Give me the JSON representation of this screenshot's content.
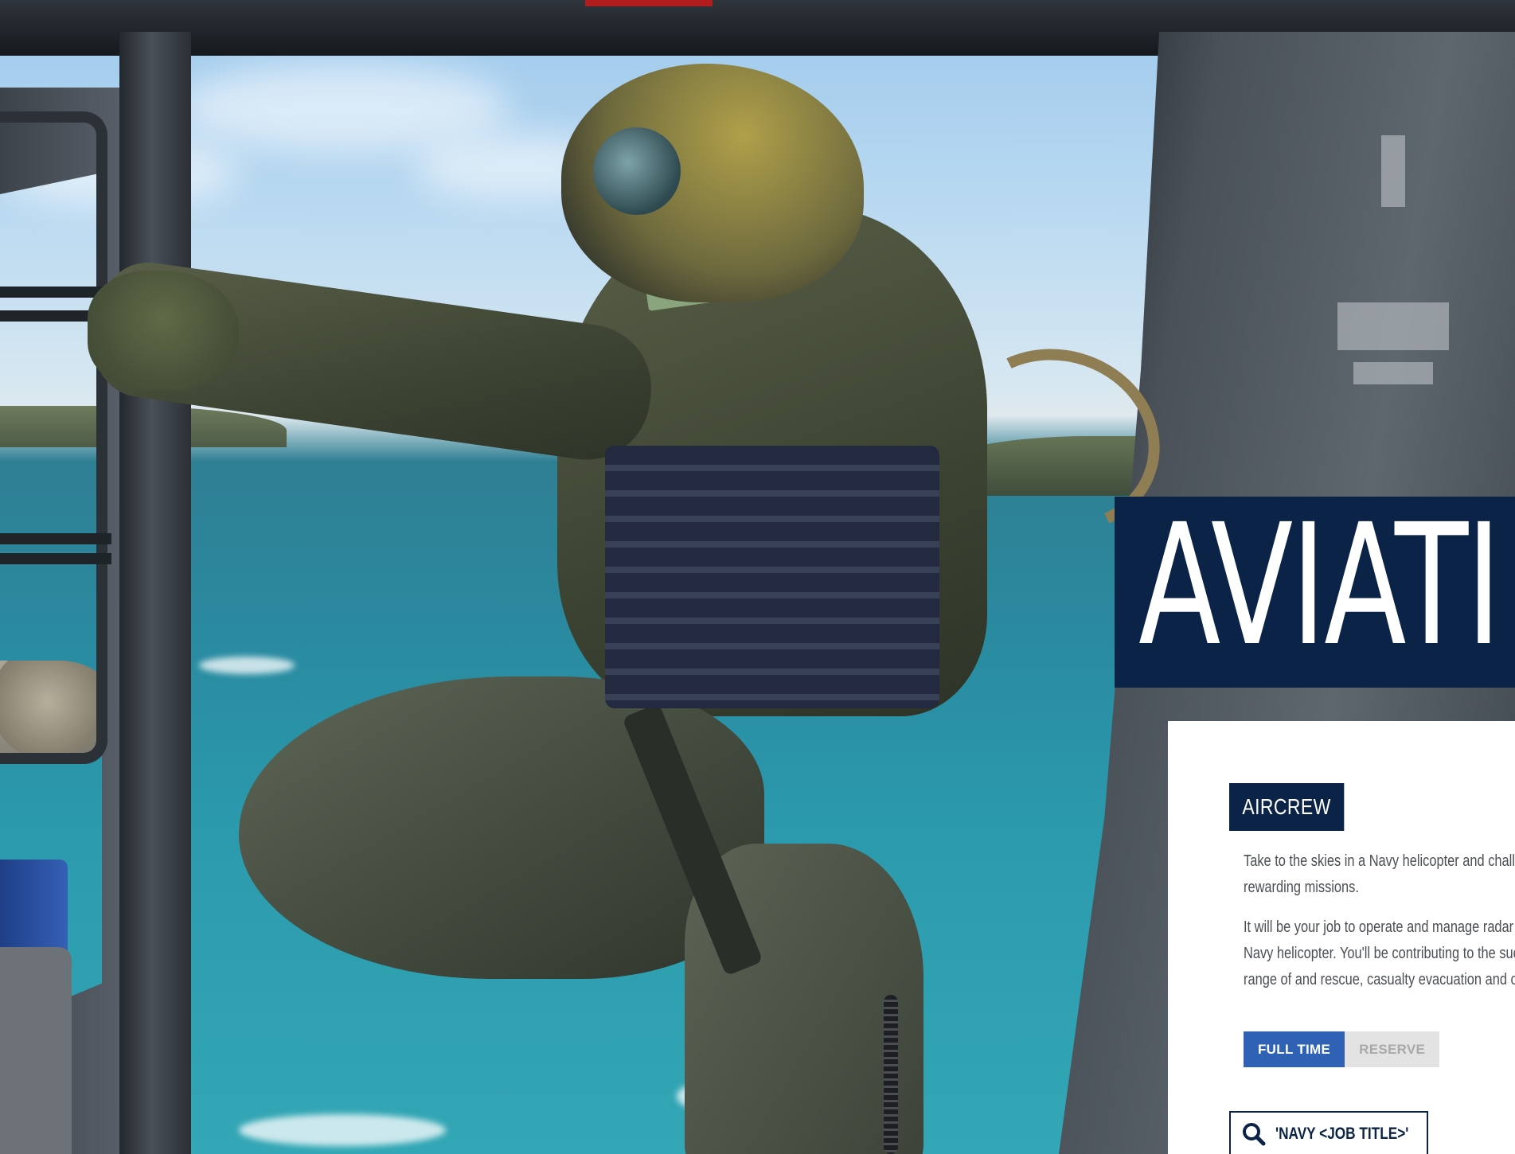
{
  "banner": {
    "title": "AVIATI"
  },
  "card": {
    "badge": "AIRCREW",
    "paragraphs": [
      "Take to the skies in a Navy helicopter and challenging and rewarding missions.",
      "It will be your job to operate and manage radar onboard a Navy helicopter. You'll be contributing to the success of a range of and rescue, casualty evacuation and com"
    ],
    "toggle": {
      "options": [
        "FULL TIME",
        "RESERVE"
      ],
      "selected": "FULL TIME"
    },
    "search": {
      "icon": "search-icon",
      "label": "'NAVY <JOB TITLE>'"
    }
  },
  "colors": {
    "navy": "#0b2347",
    "active_blue": "#2f62b5",
    "inactive_gray": "#e3e3e3",
    "body_text": "#4a4f55"
  }
}
